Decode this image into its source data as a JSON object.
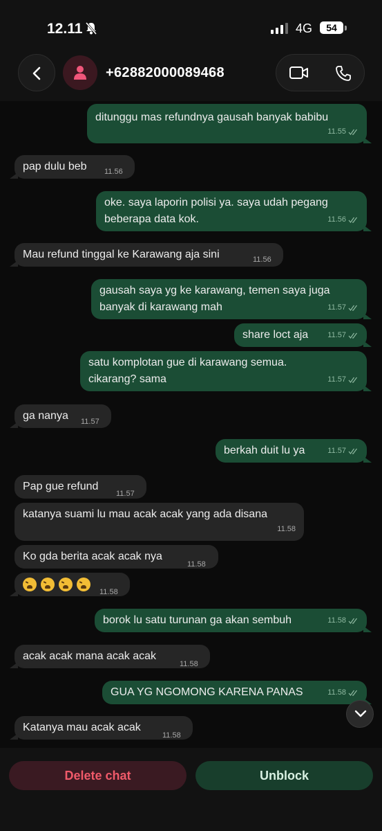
{
  "status_bar": {
    "time": "12.11",
    "network": "4G",
    "battery": "54"
  },
  "header": {
    "contact": "+62882000089468"
  },
  "messages": [
    {
      "dir": "out",
      "text": "ditunggu mas refundnya gausah banyak babibu",
      "time": "11.55"
    },
    {
      "dir": "in",
      "text": "pap dulu beb",
      "time": "11.56"
    },
    {
      "dir": "out",
      "line1": "oke. saya laporin polisi ya. saya udah pegang",
      "line2": "beberapa data kok.",
      "time": "11.56"
    },
    {
      "dir": "in",
      "text": "Mau refund tinggal ke Karawang aja sini",
      "time": "11.56"
    },
    {
      "dir": "out",
      "line1": "gausah saya yg ke karawang, temen saya juga",
      "line2": "banyak di karawang mah",
      "time": "11.57"
    },
    {
      "dir": "out",
      "text": "share loct aja",
      "time": "11.57"
    },
    {
      "dir": "out",
      "line1": "satu komplotan gue di karawang semua.",
      "line2": "cikarang? sama",
      "time": "11.57"
    },
    {
      "dir": "in",
      "text": "ga nanya",
      "time": "11.57"
    },
    {
      "dir": "out",
      "text": "berkah duit lu ya",
      "time": "11.57"
    },
    {
      "dir": "in",
      "text": "Pap gue refund",
      "time": "11.57"
    },
    {
      "dir": "in",
      "text": "katanya suami lu mau acak acak yang ada disana",
      "time": "11.58"
    },
    {
      "dir": "in",
      "text": "Ko gda berita acak acak nya",
      "time": "11.58"
    },
    {
      "dir": "in",
      "emoji": "tired-face",
      "emoji_count": 4,
      "time": "11.58"
    },
    {
      "dir": "out",
      "text": "borok lu satu turunan ga akan sembuh",
      "time": "11.58"
    },
    {
      "dir": "in",
      "text": "acak acak mana acak acak",
      "time": "11.58"
    },
    {
      "dir": "out",
      "text": "GUA YG NGOMONG KARENA PANAS",
      "time": "11.58"
    },
    {
      "dir": "in",
      "text": "Katanya mau acak acak",
      "time": "11.58"
    }
  ],
  "actions": {
    "delete": "Delete chat",
    "unblock": "Unblock"
  },
  "colors": {
    "incoming": "#262626",
    "outgoing": "#1b4d35",
    "delete_text": "#f05a6a",
    "background": "#0b0b0b"
  },
  "icons": [
    "silent-bell-icon",
    "signal-icon",
    "back-arrow-icon",
    "person-icon",
    "video-call-icon",
    "phone-icon",
    "double-check-icon",
    "chevron-down-icon"
  ]
}
